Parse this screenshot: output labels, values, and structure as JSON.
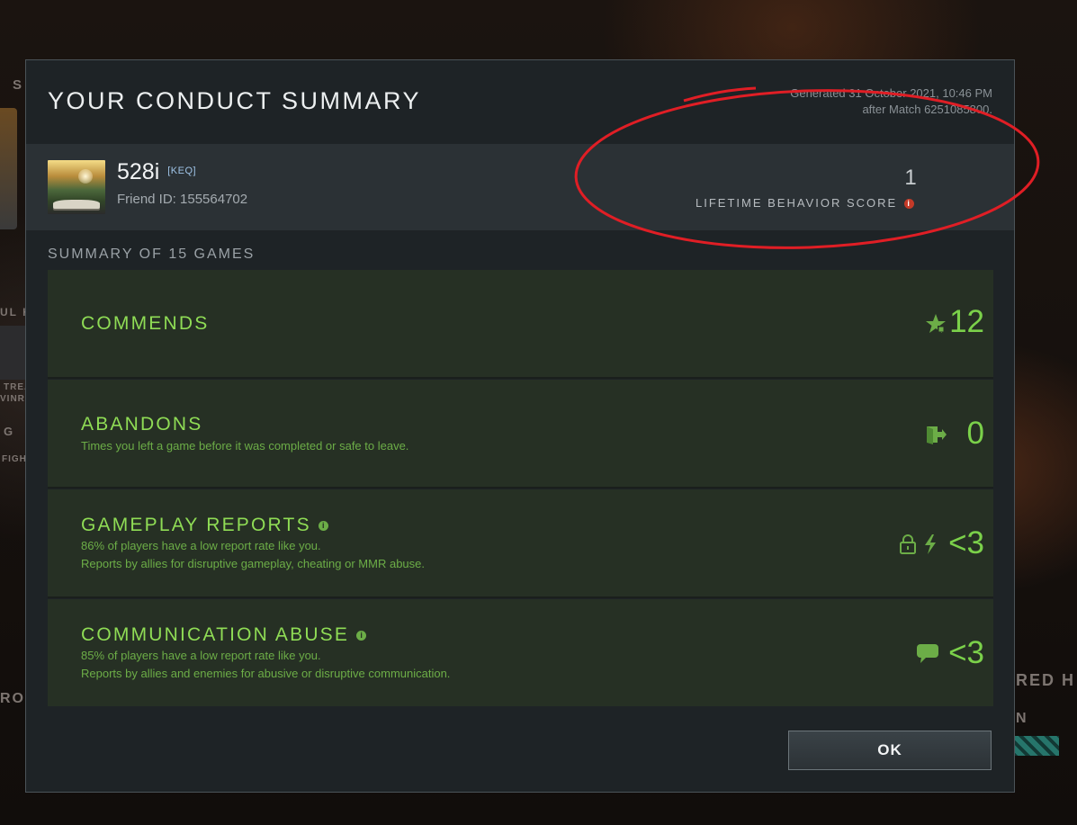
{
  "background": {
    "fragments": [
      "S",
      "UL H",
      "TREA",
      "VINRA",
      "G",
      "FIGH",
      "RED H",
      "RO",
      "N"
    ]
  },
  "dialog": {
    "title": "YOUR CONDUCT SUMMARY",
    "generated_line1": "Generated 31 October 2021, 10:46 PM",
    "generated_line2": "after Match 6251085800."
  },
  "profile": {
    "name": "528i",
    "guild_tag": "[KEQ]",
    "friend_id_label": "Friend ID:",
    "friend_id": "155564702",
    "lifetime_score": "1",
    "lifetime_score_label": "LIFETIME BEHAVIOR SCORE"
  },
  "summary": {
    "heading": "SUMMARY OF 15 GAMES",
    "rows": [
      {
        "label": "COMMENDS",
        "description_1": "",
        "description_2": "",
        "value": "12",
        "icon": "star-icon"
      },
      {
        "label": "ABANDONS",
        "description_1": "Times you left a game before it was completed or safe to leave.",
        "description_2": "",
        "value": "0",
        "icon": "exit-door-icon"
      },
      {
        "label": "GAMEPLAY REPORTS",
        "description_1": "86% of players have a low report rate like you.",
        "description_2": "Reports by allies for disruptive gameplay, cheating or MMR abuse.",
        "value": "<3",
        "icon": "lock-bolt-icon"
      },
      {
        "label": "COMMUNICATION ABUSE",
        "description_1": "85% of players have a low report rate like you.",
        "description_2": "Reports by allies and enemies for abusive or disruptive communication.",
        "value": "<3",
        "icon": "chat-bubble-icon"
      }
    ]
  },
  "ok_button": {
    "label": "OK"
  },
  "colors": {
    "accent_green": "#8fdc55",
    "annotation_red": "#e01e25",
    "info_red": "#c33a28"
  }
}
